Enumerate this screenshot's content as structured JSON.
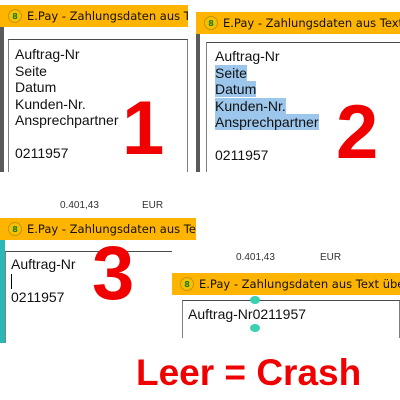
{
  "window_title": "E.Pay - Zahlungsdaten aus Text übernehmen",
  "app_icon_glyph": "8",
  "brand_color": "#ffb400",
  "accent_color": "#f00000",
  "selection_color": "#9cc6ec",
  "panels": [
    {
      "step": "1",
      "lines": [
        "Auftrag-Nr",
        "Seite",
        "Datum",
        "Kunden-Nr.",
        "Ansprechpartner",
        "",
        "0211957"
      ]
    },
    {
      "step": "2",
      "lines": [
        "Auftrag-Nr",
        "Seite",
        "Datum",
        "Kunden-Nr.",
        "Ansprechpartner",
        "",
        "0211957"
      ],
      "selected_lines": [
        "Seite",
        "Datum",
        "Kunden-Nr.",
        "Ansprechpartner"
      ]
    },
    {
      "step": "3",
      "background_text": [
        "0.401,43",
        "EUR"
      ],
      "lines": [
        "Auftrag-Nr",
        "",
        "0211957"
      ]
    },
    {
      "background_text": [
        "0.401,43",
        "EUR"
      ],
      "line": "Auftrag-Nr0211957"
    }
  ],
  "caption": "Leer = Crash"
}
